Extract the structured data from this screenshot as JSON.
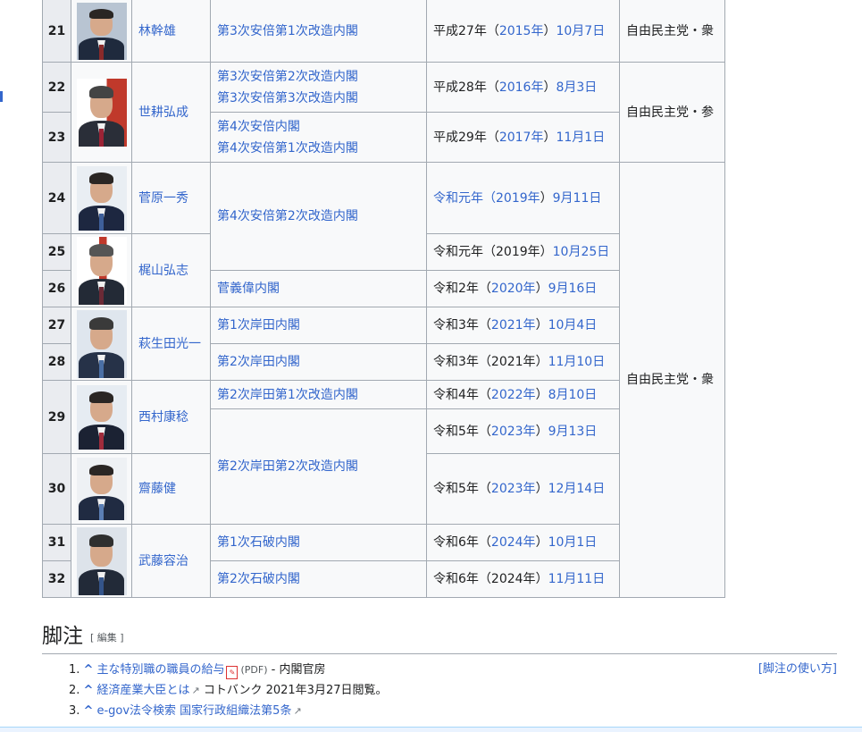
{
  "table": {
    "rows": [
      {
        "num": "21",
        "name": "林幹雄",
        "cabinet": "第3次安倍第1次改造内閣",
        "date": {
          "era": "平成27年（",
          "year": "2015年",
          "close": "）",
          "md": "10月7日",
          "year_link": true
        },
        "party": "自由民主党・衆"
      },
      {
        "num": "22",
        "name": "世耕弘成",
        "cabinet_lines": [
          "第3次安倍第2次改造内閣",
          "第3次安倍第3次改造内閣"
        ],
        "date": {
          "era": "平成28年（",
          "year": "2016年",
          "close": "）",
          "md": "8月3日",
          "year_link": true
        },
        "party": "自由民主党・参"
      },
      {
        "num": "23",
        "cabinet_lines": [
          "第4次安倍内閣",
          "第4次安倍第1次改造内閣"
        ],
        "date": {
          "era": "平成29年（",
          "year": "2017年",
          "close": "）",
          "md": "11月1日",
          "year_link": true
        }
      },
      {
        "num": "24",
        "name": "菅原一秀",
        "cabinet": "第4次安倍第2次改造内閣",
        "date": {
          "era": "令和元年（",
          "year": "2019年",
          "close": "）",
          "md": "9月11日",
          "year_link": true,
          "era_link": true
        },
        "party": "自由民主党・衆"
      },
      {
        "num": "25",
        "name": "梶山弘志",
        "date": {
          "era": "令和元年（",
          "year": "2019年",
          "close": "）",
          "md": "10月25日",
          "year_link": false
        }
      },
      {
        "num": "26",
        "cabinet": "菅義偉内閣",
        "date": {
          "era": "令和2年（",
          "year": "2020年",
          "close": "）",
          "md": "9月16日",
          "year_link": true
        }
      },
      {
        "num": "27",
        "name": "萩生田光一",
        "cabinet": "第1次岸田内閣",
        "date": {
          "era": "令和3年（",
          "year": "2021年",
          "close": "）",
          "md": "10月4日",
          "year_link": true
        }
      },
      {
        "num": "28",
        "cabinet": "第2次岸田内閣",
        "date": {
          "era": "令和3年（",
          "year": "2021年",
          "close": "）",
          "md": "11月10日",
          "year_link": false
        }
      },
      {
        "num": "29",
        "name": "西村康稔",
        "cabinet": "第2次岸田第1次改造内閣",
        "date": {
          "era": "令和4年（",
          "year": "2022年",
          "close": "）",
          "md": "8月10日",
          "year_link": true
        }
      },
      {
        "cabinet": "第2次岸田第2次改造内閣",
        "date": {
          "era": "令和5年（",
          "year": "2023年",
          "close": "）",
          "md": "9月13日",
          "year_link": true
        }
      },
      {
        "num": "30",
        "name": "齋藤健",
        "date": {
          "era": "令和5年（",
          "year": "2023年",
          "close": "）",
          "md": "12月14日",
          "year_link": true
        }
      },
      {
        "num": "31",
        "name": "武藤容治",
        "cabinet": "第1次石破内閣",
        "date": {
          "era": "令和6年（",
          "year": "2024年",
          "close": "）",
          "md": "10月1日",
          "year_link": true
        }
      },
      {
        "num": "32",
        "cabinet": "第2次石破内閣",
        "date": {
          "era": "令和6年（",
          "year": "2024年",
          "close": "）",
          "md": "11月11日",
          "year_link": false
        }
      }
    ]
  },
  "footnotes": {
    "heading": "脚注",
    "edit": "[ 編集 ]",
    "help_link": "[脚注の使い方]",
    "caret": "^",
    "items": [
      {
        "marker": "1.",
        "link": "主な特別職の職員の給与",
        "pdf_label": "(PDF)",
        "rest": " - 内閣官房"
      },
      {
        "marker": "2.",
        "link": "経済産業大臣とは",
        "rest": " コトバンク 2021年3月27日閲覧。"
      },
      {
        "marker": "3.",
        "link": "e-gov法令検索 国家行政組織法第5条",
        "rest": ""
      }
    ]
  },
  "icons": {
    "pdf": "pdf-icon",
    "external": "external-link-icon"
  },
  "colors": {
    "link": "#3366cc",
    "border": "#a2a9b1",
    "cell_bg": "#f8f9fa",
    "header_bg": "#eaecf0"
  }
}
